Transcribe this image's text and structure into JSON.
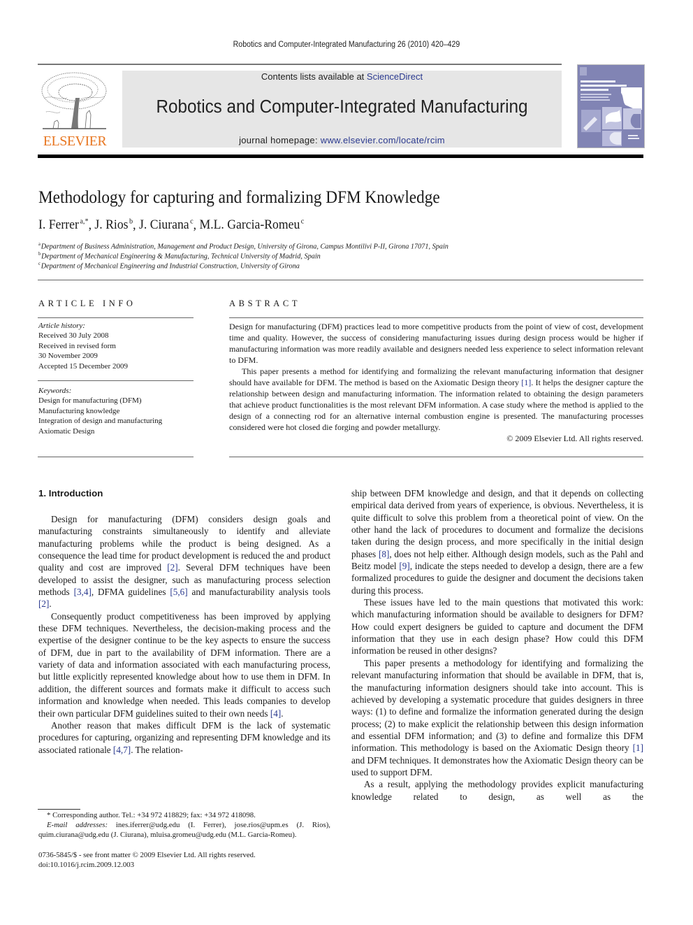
{
  "running_head": "Robotics and Computer-Integrated Manufacturing 26 (2010) 420–429",
  "masthead": {
    "publisher_logo_text": "ELSEVIER",
    "contents_prefix": "Contents lists available at ",
    "contents_link": "ScienceDirect",
    "journal_title": "Robotics and Computer-Integrated Manufacturing",
    "homepage_prefix": "journal homepage: ",
    "homepage_link": "www.elsevier.com/locate/rcim",
    "band_color": "#e6e6e6",
    "logo_color": "#e87722",
    "cover_color": "#8184b4",
    "link_color": "#2b3a8f"
  },
  "article": {
    "title": "Methodology for capturing and formalizing DFM Knowledge",
    "authors": [
      {
        "name": "I. Ferrer",
        "sup": "a,*"
      },
      {
        "name": "J. Rios",
        "sup": "b"
      },
      {
        "name": "J. Ciurana",
        "sup": "c"
      },
      {
        "name": "M.L. Garcia-Romeu",
        "sup": "c"
      }
    ],
    "affiliations": [
      {
        "sup": "a",
        "text": "Department of Business Administration, Management and Product Design, University of Girona, Campus Montilivi P-II, Girona 17071, Spain"
      },
      {
        "sup": "b",
        "text": "Department of Mechanical Engineering & Manufacturing, Technical University of Madrid, Spain"
      },
      {
        "sup": "c",
        "text": "Department of Mechanical Engineering and Industrial Construction, University of Girona"
      }
    ]
  },
  "article_info": {
    "heading": "ARTICLE INFO",
    "history_label": "Article history:",
    "history": [
      "Received 30 July 2008",
      "Received in revised form",
      "30 November 2009",
      "Accepted 15 December 2009"
    ],
    "keywords_label": "Keywords:",
    "keywords": [
      "Design for manufacturing (DFM)",
      "Manufacturing knowledge",
      "Integration of design and manufacturing",
      "Axiomatic Design"
    ]
  },
  "abstract": {
    "heading": "ABSTRACT",
    "p1": "Design for manufacturing (DFM) practices lead to more competitive products from the point of view of cost, development time and quality. However, the success of considering manufacturing issues during design process would be higher if manufacturing information was more readily available and designers needed less experience to select information relevant to DFM.",
    "p2_a": "This paper presents a method for identifying and formalizing the relevant manufacturing information that designer should have available for DFM. The method is based on the Axiomatic Design theory ",
    "p2_ref": "[1]",
    "p2_b": ". It helps the designer capture the relationship between design and manufacturing information. The information related to obtaining the design parameters that achieve product functionalities is the most relevant DFM information. A case study where the method is applied to the design of a connecting rod for an alternative internal combustion engine is presented. The manufacturing processes considered were hot closed die forging and powder metallurgy.",
    "copyright": "© 2009 Elsevier Ltd. All rights reserved."
  },
  "introduction": {
    "heading": "1.  Introduction",
    "left": {
      "p1": [
        "Design for manufacturing (DFM) considers design goals and manufacturing constraints simultaneously to identify and alleviate manufacturing problems while the product is being designed. As a consequence the lead time for product development is reduced the and product quality and cost are improved ",
        "[2]",
        ". Several DFM techniques have been developed to assist the designer, such as manufacturing process selection methods ",
        "[3,4]",
        ", DFMA guidelines ",
        "[5,6]",
        " and manufacturability analysis tools ",
        "[2]",
        "."
      ],
      "p2": [
        "Consequently product competitiveness has been improved by applying these DFM techniques. Nevertheless, the decision-making process and the expertise of the designer continue to be the key aspects to ensure the success of DFM, due in part to the availability of DFM information. There are a variety of data and information associated with each manufacturing process, but little explicitly represented knowledge about how to use them in DFM. In addition, the different sources and formats make it difficult to access such information and knowledge when needed. This leads companies to develop their own particular DFM guidelines suited to their own needs ",
        "[4]",
        "."
      ],
      "p3": [
        "Another reason that makes difficult DFM is the lack of systematic procedures for capturing, organizing and representing DFM knowledge and its associated rationale ",
        "[4,7]",
        ". The relation-"
      ]
    },
    "right": {
      "p1": [
        "ship between DFM knowledge and design, and that it depends on collecting empirical data derived from years of experience, is obvious. Nevertheless, it is quite difficult to solve this problem from a theoretical point of view. On the other hand the lack of procedures to document and formalize the decisions taken during the design process, and more specifically in the initial design phases ",
        "[8]",
        ", does not help either. Although design models, such as the Pahl and Beitz model ",
        "[9]",
        ", indicate the steps needed to develop a design, there are a few formalized procedures to guide the designer and document the decisions taken during this process."
      ],
      "p2": "These issues have led to the main questions that motivated this work: which manufacturing information should be available to designers for DFM? How could expert designers be guided to capture and document the DFM information that they use in each design phase? How could this DFM information be reused in other designs?",
      "p3": [
        "This paper presents a methodology for identifying and formalizing the relevant manufacturing information that should be available in DFM, that is, the manufacturing information designers should take into account. This is achieved by developing a systematic procedure that guides designers in three ways: (1) to define and formalize the information generated during the design process; (2) to make explicit the relationship between this design information and essential DFM information; and (3) to define and formalize this DFM information. This methodology is based on the Axiomatic Design theory ",
        "[1]",
        " and DFM techniques. It demonstrates how the Axiomatic Design theory can be used to support DFM."
      ],
      "p4": "As a result, applying the methodology provides explicit manufacturing knowledge related to design, as well as the"
    }
  },
  "footnotes": {
    "corresponding": "* Corresponding author. Tel.: +34 972 418829; fax: +34 972 418098.",
    "email_label": "E-mail addresses:",
    "emails": " ines.iferrer@udg.edu (I. Ferrer), jose.rios@upm.es (J. Rios), quim.ciurana@udg.edu (J. Ciurana), mluisa.gromeu@udg.edu (M.L. Garcia-Romeu).",
    "front_matter": "0736-5845/$ - see front matter © 2009 Elsevier Ltd. All rights reserved.",
    "doi": "doi:10.1016/j.rcim.2009.12.003"
  }
}
